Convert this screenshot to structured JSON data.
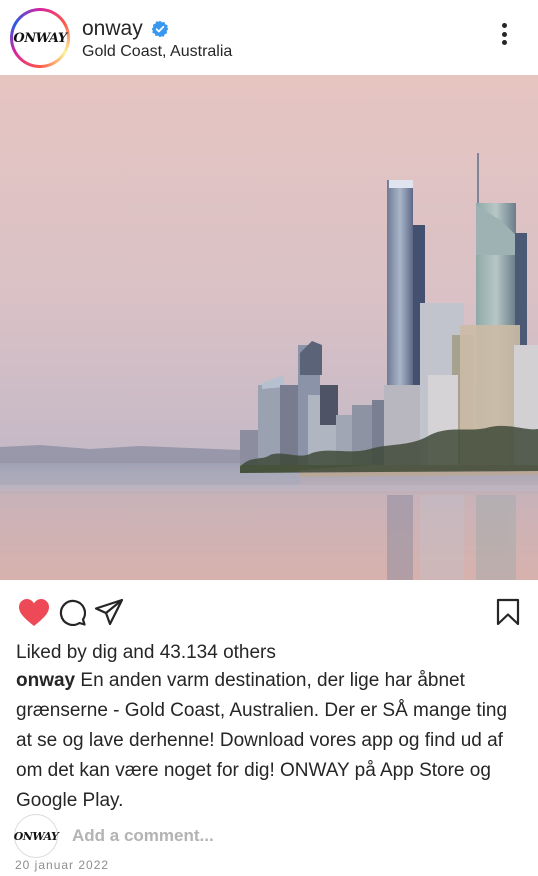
{
  "post": {
    "username": "onway",
    "location": "Gold Coast, Australia",
    "avatar_logo_text": "ONWAY",
    "liked_by_prefix": "Liked by",
    "liked_by_user": "dig",
    "liked_by_and": "and",
    "liked_by_count": "43.134 others",
    "caption_user": "onway",
    "caption_text": "En anden varm destination, der lige har åbnet grænserne - Gold Coast, Australien. Der er SÅ mange ting at se og lave derhenne! Download vores app og find ud af om det kan være noget for dig! ONWAY på App Store og Google Play.",
    "comment_placeholder": "Add a comment...",
    "date": "20 januar 2022",
    "liked": true
  },
  "icons": {
    "verified": "verified-badge-icon",
    "more": "more-options-icon",
    "like": "heart-icon",
    "comment": "comment-icon",
    "share": "paper-plane-icon",
    "save": "bookmark-icon"
  },
  "colors": {
    "heart": "#ed4956",
    "verified": "#3897f0",
    "muted": "#8e8e8e",
    "text": "#262626"
  }
}
